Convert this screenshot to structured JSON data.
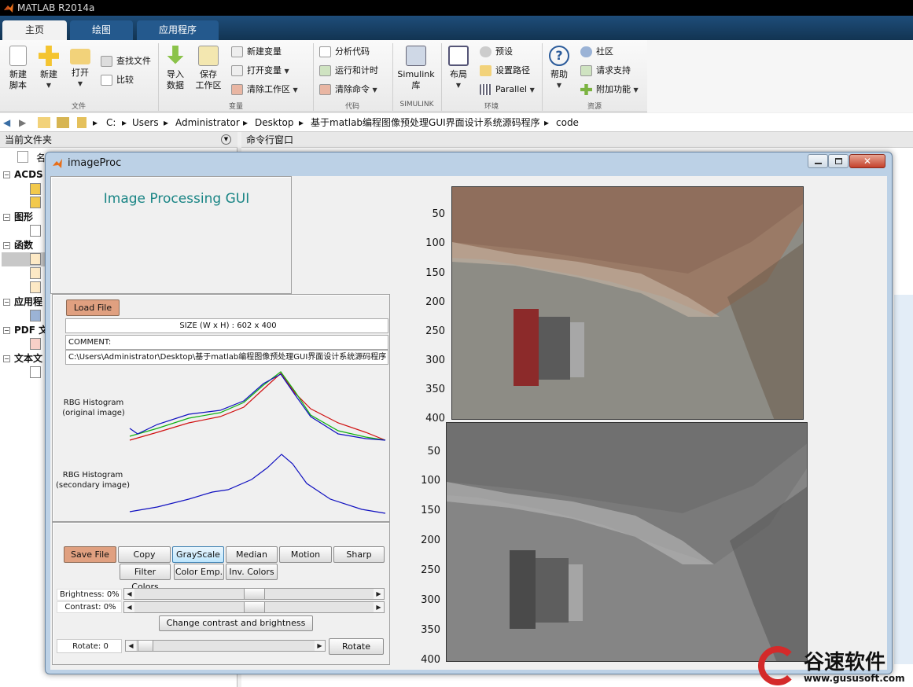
{
  "app_title": "MATLAB R2014a",
  "tabs": [
    "主页",
    "绘图",
    "应用程序"
  ],
  "ribbon": {
    "new_script": "新建\n脚本",
    "new": "新建",
    "open": "打开",
    "find_files": "查找文件",
    "compare": "比较",
    "import": "导入\n数据",
    "save_ws": "保存\n工作区",
    "new_var": "新建变量",
    "open_var": "打开变量",
    "clear_ws": "清除工作区",
    "analyze": "分析代码",
    "run_time": "运行和计时",
    "clear_cmd": "清除命令",
    "simulink": "Simulink\n库",
    "layout": "布局",
    "prefs": "预设",
    "set_path": "设置路径",
    "parallel": "Parallel",
    "help": "帮助",
    "community": "社区",
    "support": "请求支持",
    "addons": "附加功能",
    "groups": [
      "文件",
      "变量",
      "代码",
      "SIMULINK",
      "环境",
      "资源"
    ]
  },
  "path": [
    "C:",
    "Users",
    "Administrator",
    "Desktop",
    "基于matlab编程图像预处理GUI界面设计系统源码程序",
    "code"
  ],
  "left_panel": {
    "title": "当前文件夹",
    "col_name": "名",
    "tree": [
      "ACDS",
      "图形",
      "函数",
      "应用程",
      "PDF 文",
      "文本文"
    ]
  },
  "cmd_title": "命令行窗口",
  "window": {
    "title": "imageProc",
    "heading": "Image Processing GUI",
    "load_file": "Load File",
    "size_text": "SIZE (W x H) : 602 x 400",
    "comment": "COMMENT:",
    "file_path": "C:\\Users\\Administrator\\Desktop\\基于matlab编程图像预处理GUI界面设计系统源码程序",
    "hist1_label": "RBG Histogram\n(original image)",
    "hist2_label": "RBG Histogram\n(secondary image)",
    "buttons": [
      "Save File",
      "Copy",
      "GrayScale",
      "Median",
      "Motion",
      "Sharp",
      "Filter Colors",
      "Color Emp.",
      "Inv. Colors"
    ],
    "brightness": "Brightness:  0%",
    "contrast": "Contrast:  0%",
    "change_btn": "Change contrast and brightness",
    "rotate_label": "Rotate:  0",
    "rotate_btn": "Rotate",
    "ticks_top": [
      "50",
      "100",
      "150",
      "200",
      "250",
      "300",
      "350",
      "400"
    ],
    "ticks_bottom": [
      "50",
      "100",
      "150",
      "200",
      "250",
      "300",
      "350",
      "400"
    ]
  },
  "watermark": {
    "brand": "谷速软件",
    "url": "www.gususoft.com"
  },
  "colors": {
    "accent": "#1a8585",
    "orange_button": "#e0a080",
    "titlebar": "#000000"
  }
}
